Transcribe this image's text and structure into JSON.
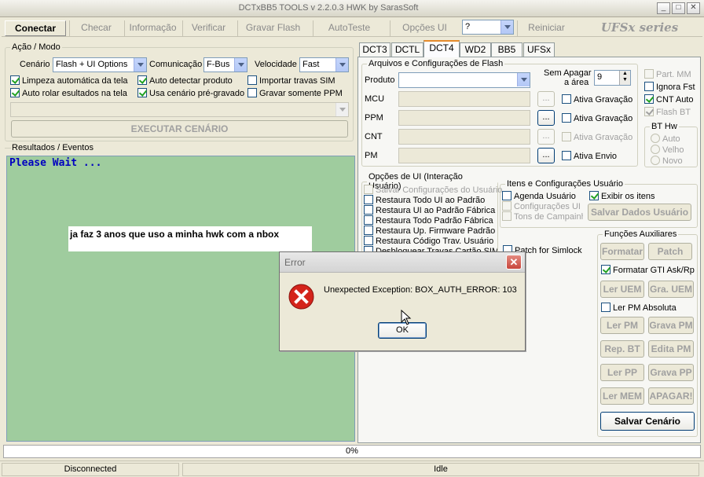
{
  "window": {
    "title": "DCTxBB5 TOOLS v 2.2.0.3 HWK by SarasSoft"
  },
  "menu": {
    "conectar": "Conectar",
    "checar": "Checar",
    "informacao": "Informação",
    "verificar": "Verificar",
    "gravar_flash": "Gravar Flash",
    "autoteste": "AutoTeste",
    "opcoes_ui": "Opções UI",
    "model_value": "?",
    "reiniciar": "Reiniciar",
    "logo": "UFSx series"
  },
  "acao_modo": {
    "legend": "Ação / Modo",
    "cenario_label": "Cenário",
    "cenario_value": "Flash + UI Options",
    "comunicacao_label": "Comunicação",
    "comunicacao_value": "F-Bus",
    "velocidade_label": "Velocidade",
    "velocidade_value": "Fast",
    "chk_limpeza": "Limpeza automática da tela",
    "chk_auto_detectar": "Auto detectar produto",
    "chk_importar": "Importar travas SIM",
    "chk_auto_rolar": "Auto rolar esultados na tela",
    "chk_usa_cenario": "Usa cenário pré-gravado",
    "chk_gravar_ppm": "Gravar somente PPM",
    "executar": "EXECUTAR CENÁRIO"
  },
  "results": {
    "legend": "Resultados / Eventos",
    "line1": "Please Wait ...",
    "overlay_text": "ja faz 3 anos que uso a minha hwk com a nbox"
  },
  "tabs": [
    "DCT3",
    "DCTL",
    "DCT4",
    "WD2",
    "BB5",
    "UFSx"
  ],
  "flash": {
    "legend": "Arquivos e Configurações de Flash",
    "produto": "Produto",
    "mcu": "MCU",
    "ppm": "PPM",
    "cnt": "CNT",
    "pm": "PM",
    "sem_apagar": "Sem Apagar",
    "a_area": "a área",
    "area_value": "9",
    "ativa_gravacao_mcu": "Ativa Gravação",
    "ativa_gravacao_ppm": "Ativa Gravação",
    "ativa_gravacao_cnt": "Ativa Gravação",
    "ativa_envio": "Ativa Envio",
    "dots": "...",
    "part_mm": "Part. MM",
    "ignora_fst": "Ignora Fst",
    "cnt_auto": "CNT Auto",
    "flash_bt": "Flash BT",
    "bt_hw": "BT Hw",
    "auto": "Auto",
    "velho": "Velho",
    "novo": "Novo"
  },
  "ui_options": {
    "legend": "Opções de UI (Interação Usuário)",
    "items": [
      "Salvar Configurações do Usuário",
      "Restaura Todo UI ao Padrão",
      "Restaura UI ao Padrão Fábrica",
      "Restaura Todo Padrão Fábrica",
      "Restaura Up. Firmware Padrão",
      "Restaura Código Trav. Usuário",
      "Desbloquear Travas Cartão SIM"
    ],
    "patch_simlock": "Patch for Simlock"
  },
  "itens": {
    "legend": "Itens e Configurações Usuário",
    "agenda": "Agenda Usuário",
    "config_ui": "Configurações UI",
    "tons": "Tons de Campainha",
    "exibir": "Exibir os itens",
    "salvar_dados": "Salvar Dados Usuário"
  },
  "funcoes": {
    "legend": "Funções Auxiliares",
    "formatar": "Formatar",
    "patch": "Patch",
    "formatar_gti": "Formatar GTI Ask/Rp",
    "ler_uem": "Ler UEM",
    "gra_uem": "Gra. UEM",
    "ler_pm_absoluta": "Ler PM Absoluta",
    "ler_pm": "Ler PM",
    "grava_pm": "Grava PM",
    "rep_bt": "Rep. BT",
    "edita_pm": "Edita PM",
    "ler_pp": "Ler PP",
    "grava_pp": "Grava PP",
    "ler_mem": "Ler MEM",
    "apagar": "APAGAR!",
    "salvar_cenario": "Salvar Cenário"
  },
  "progress": {
    "text": "0%",
    "value": 0
  },
  "statusbar": {
    "connection": "Disconnected",
    "state": "Idle"
  },
  "dialog": {
    "title": "Error",
    "message": "Unexpected Exception: BOX_AUTH_ERROR: 103",
    "ok": "OK"
  },
  "colors": {
    "results_bg": "#9fcc9e",
    "please_wait": "#0000c0",
    "error_red": "#d4241b",
    "dialog_close": "#c8463c"
  }
}
